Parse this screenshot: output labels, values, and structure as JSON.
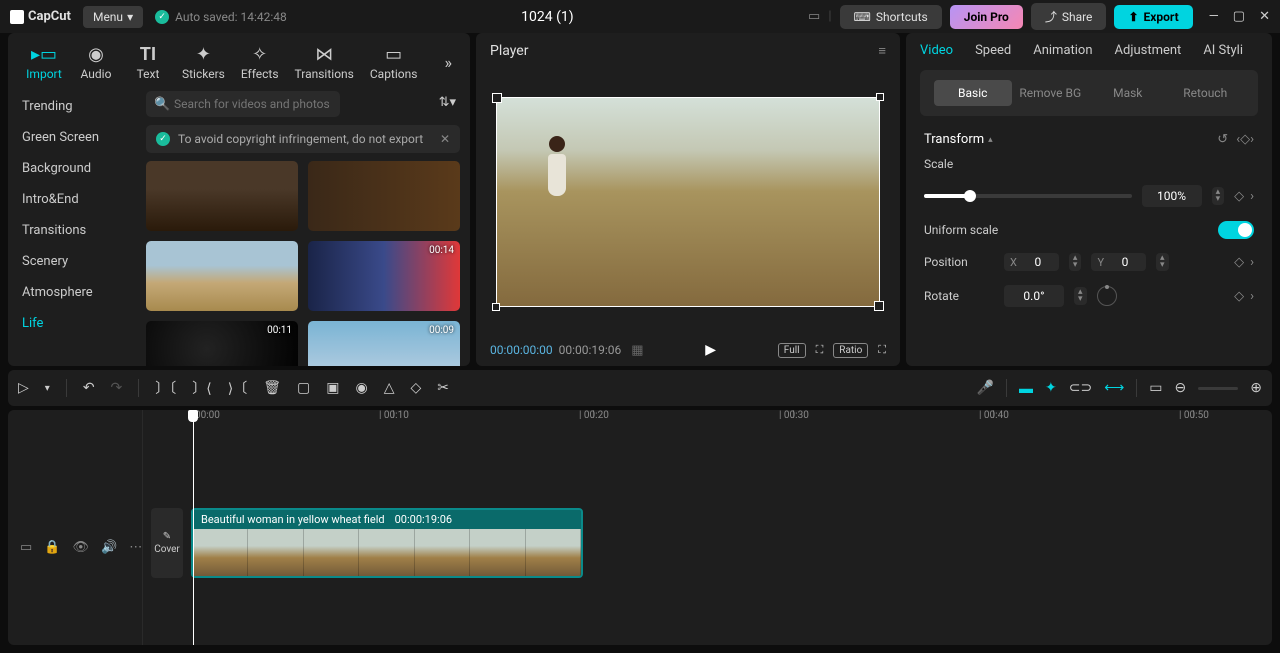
{
  "titlebar": {
    "app": "CapCut",
    "menu": "Menu",
    "autosave": "Auto saved: 14:42:48",
    "project": "1024 (1)",
    "shortcuts": "Shortcuts",
    "joinpro": "Join Pro",
    "share": "Share",
    "export": "Export"
  },
  "tabs": [
    "Import",
    "Audio",
    "Text",
    "Stickers",
    "Effects",
    "Transitions",
    "Captions"
  ],
  "sidebar": [
    "Trending",
    "Green Screen",
    "Background",
    "Intro&End",
    "Transitions",
    "Scenery",
    "Atmosphere",
    "Life"
  ],
  "search_placeholder": "Search for videos and photos",
  "notice": "To avoid copyright infringement, do not export",
  "thumb_times": [
    "",
    "",
    "",
    "00:14",
    "00:11",
    "00:09"
  ],
  "player": {
    "title": "Player",
    "current": "00:00:00:00",
    "duration": "00:00:19:06",
    "full": "Full",
    "ratio": "Ratio"
  },
  "rtabs": [
    "Video",
    "Speed",
    "Animation",
    "Adjustment",
    "AI Styli"
  ],
  "subtabs": [
    "Basic",
    "Remove BG",
    "Mask",
    "Retouch"
  ],
  "transform": {
    "title": "Transform",
    "scale_label": "Scale",
    "scale_value": "100%",
    "uniform_label": "Uniform scale",
    "position_label": "Position",
    "pos_x": "0",
    "pos_y": "0",
    "rotate_label": "Rotate",
    "rotate_value": "0.0°"
  },
  "ruler": [
    "00:00",
    "00:10",
    "00:20",
    "00:30",
    "00:40",
    "00:50"
  ],
  "clip": {
    "name": "Beautiful woman in yellow wheat field",
    "duration": "00:00:19:06"
  },
  "cover": "Cover"
}
